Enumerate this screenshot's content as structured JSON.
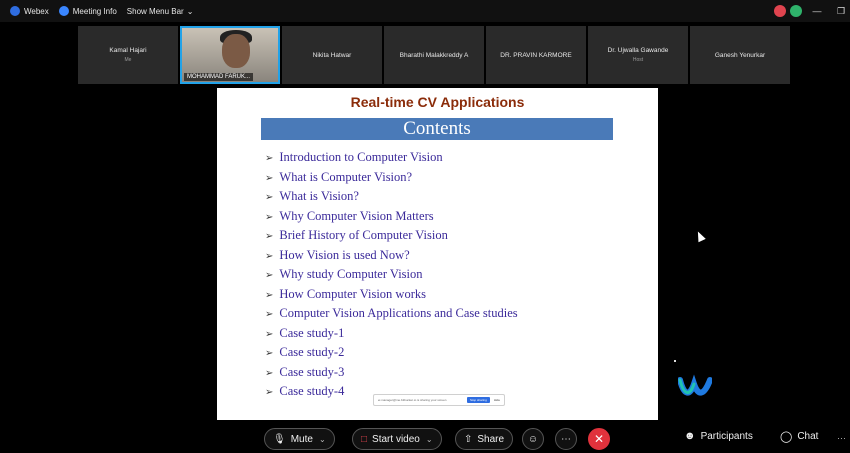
{
  "topbar": {
    "app_name": "Webex",
    "meeting_info": "Meeting Info",
    "show_menu_bar": "Show Menu Bar"
  },
  "participants": [
    {
      "name": "Kamal Hajari",
      "sub": "Me"
    },
    {
      "name": "MOHAMMAD FARUK...",
      "sub": "",
      "video": true
    },
    {
      "name": "Nikita Hatwar",
      "sub": ""
    },
    {
      "name": "Bharathi Malakkreddy A",
      "sub": ""
    },
    {
      "name": "DR. PRAVIN KARMORE",
      "sub": ""
    },
    {
      "name": "Dr. Ujwalla Gawande",
      "sub": "Host"
    },
    {
      "name": "Ganesh Yenurkar",
      "sub": ""
    }
  ],
  "slide": {
    "title": "Real-time CV Applications",
    "heading": "Contents",
    "items": [
      "Introduction to Computer Vision",
      "What is Computer Vision?",
      "What is Vision?",
      "Why Computer Vision Matters",
      "Brief History of Computer Vision",
      "How Vision is used Now?",
      "Why study Computer Vision",
      "How Computer Vision works",
      "Computer Vision Applications and Case studies",
      "Case study-1",
      "Case study-2",
      "Case study-3",
      "Case study-4"
    ],
    "bullet_glyph": "➢",
    "share_bar": {
      "text": "ei.manager@me.bitbucket.io is sharing your screen",
      "stop": "Stop sharing",
      "hide": "Hide"
    }
  },
  "controls": {
    "mute": "Mute",
    "start_video": "Start video",
    "share": "Share",
    "participants": "Participants",
    "chat": "Chat"
  },
  "colors": {
    "slide_title": "#8b2c0a",
    "contents_bar": "#4a7ab8",
    "toc_text": "#3b2a9a",
    "leave": "#e0323c",
    "accent": "#22a2e8"
  }
}
